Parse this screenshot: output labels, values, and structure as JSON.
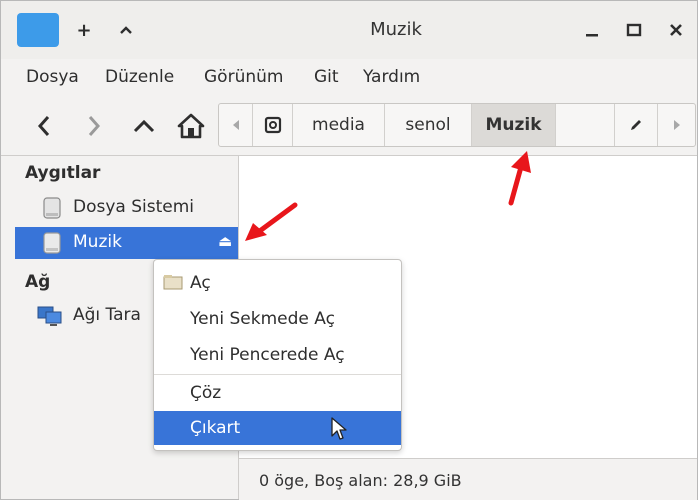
{
  "window": {
    "title": "Muzik"
  },
  "titlebar": {
    "new_tab_symbol": "+",
    "up_symbol": "^",
    "minimize_symbol": "_",
    "maximize_symbol": "□",
    "close_symbol": "✕"
  },
  "menubar": [
    "Dosya",
    "Düzenle",
    "Görünüm",
    "Git",
    "Yardım"
  ],
  "path": {
    "segments": [
      "media",
      "senol",
      "Muzik"
    ],
    "active_index": 2
  },
  "sidebar": {
    "devices_heading": "Aygıtlar",
    "devices": [
      {
        "label": "Dosya Sistemi",
        "icon": "drive-icon"
      },
      {
        "label": "Muzik",
        "icon": "drive-icon",
        "selected": true,
        "eject": "⏏"
      }
    ],
    "network_heading": "Ağ",
    "network": [
      {
        "label": "Ağı Tara",
        "icon": "network-icon"
      }
    ]
  },
  "context_menu": {
    "items": [
      "Aç",
      "Yeni Sekmede Aç",
      "Yeni Pencerede Aç",
      "Çöz",
      "Çıkart"
    ],
    "hovered_index": 4
  },
  "status": {
    "text": "0 öge, Boş alan: 28,9 GiB"
  },
  "colors": {
    "selection": "#3874d8",
    "annotation_arrow": "#e8161b",
    "folder": "#3d9be9"
  }
}
